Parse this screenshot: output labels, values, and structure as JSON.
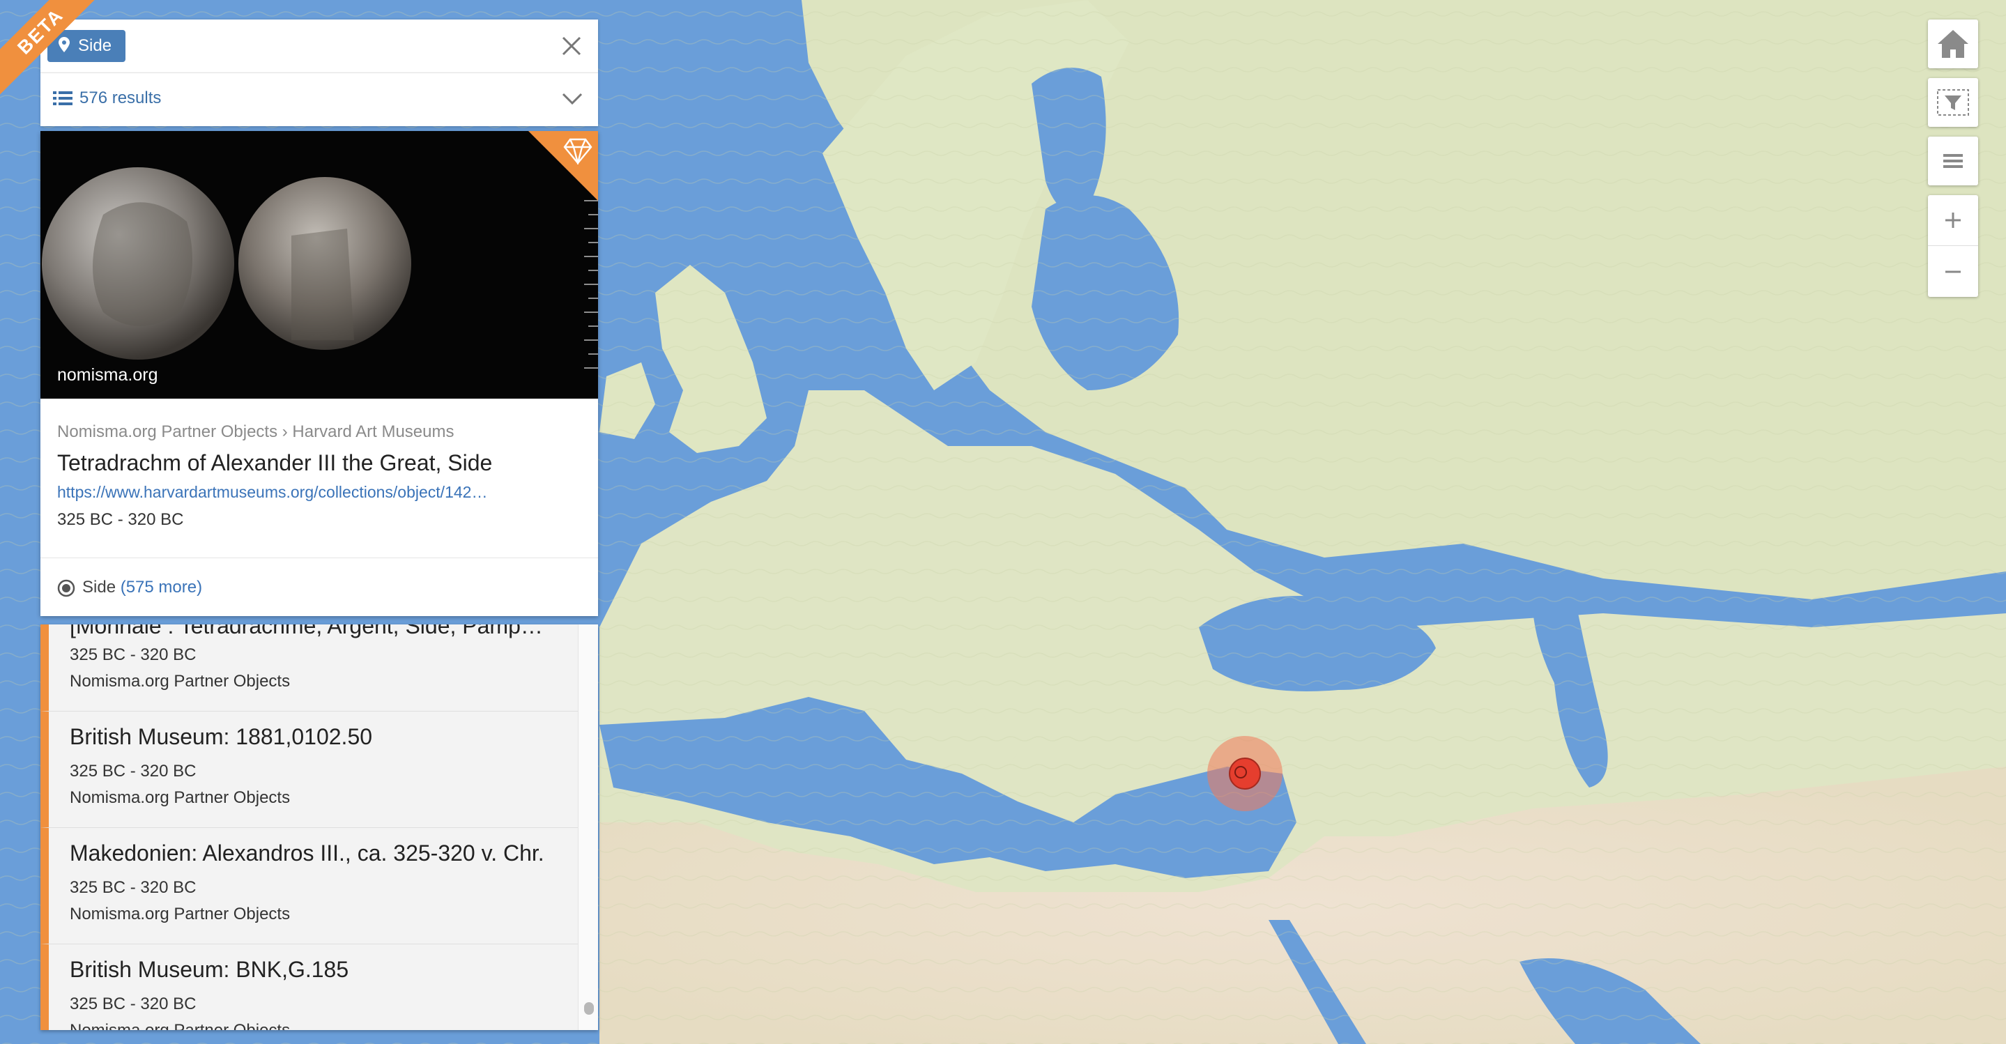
{
  "badge": {
    "label": "BETA"
  },
  "search": {
    "tag_label": "Side",
    "close_icon": "close-icon",
    "pin_icon": "map-pin-icon"
  },
  "results": {
    "count_label": "576 results",
    "list_icon": "list-icon",
    "toggle_icon": "chevron-down-icon"
  },
  "card": {
    "image_credit": "nomisma.org",
    "premium_icon": "diamond-icon",
    "breadcrumb": "Nomisma.org Partner Objects › Harvard Art Museums",
    "title": "Tetradrachm of Alexander III the Great, Side",
    "link": "https://www.harvardartmuseums.org/collections/object/142…",
    "date": "325 BC - 320 BC",
    "place_label": "Side",
    "place_more": "(575 more)"
  },
  "result_list": [
    {
      "title": "[Monnaie : Tetradrachme, Argent, Side, Pamp…",
      "date": "325 BC - 320 BC",
      "source": "Nomisma.org Partner Objects"
    },
    {
      "title": "British Museum: 1881,0102.50",
      "date": "325 BC - 320 BC",
      "source": "Nomisma.org Partner Objects"
    },
    {
      "title": "Makedonien: Alexandros III., ca. 325-320 v. Chr.",
      "date": "325 BC - 320 BC",
      "source": "Nomisma.org Partner Objects"
    },
    {
      "title": "British Museum: BNK,G.185",
      "date": "325 BC - 320 BC",
      "source": "Nomisma.org Partner Objects"
    }
  ],
  "map_controls": {
    "home": "home-icon",
    "filter": "filter-icon",
    "layers": "layers-icon",
    "zoom_in": "plus-icon",
    "zoom_out": "minus-icon"
  },
  "colors": {
    "accent": "#f0903e",
    "link": "#3a73b8",
    "tag": "#4a7fb8",
    "sea": "#6a9ed9",
    "land": "#dfe5c4",
    "marker": "#e53e2e"
  }
}
